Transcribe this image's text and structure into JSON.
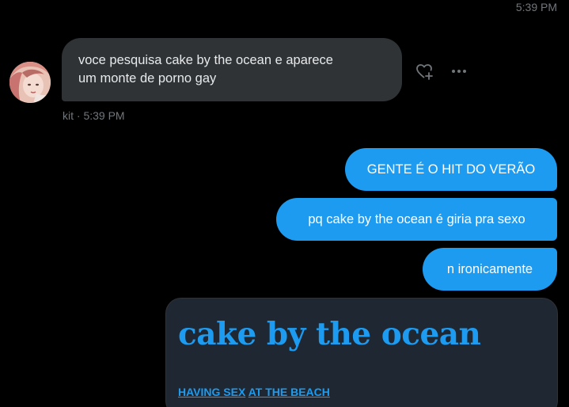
{
  "header": {
    "timestamp": "5:39 PM"
  },
  "incoming_message": {
    "text_line_1": "voce pesquisa cake by the ocean e aparece",
    "text_line_2": "um monte de porno gay",
    "sender_meta": "kit · 5:39 PM",
    "avatar": "user-avatar-photo",
    "actions": {
      "react_icon": "heart-plus-icon",
      "more_icon": "more-horizontal-icon"
    }
  },
  "outgoing_messages": [
    {
      "text": "GENTE É O HIT DO VERÃO"
    },
    {
      "text": "pq cake by the ocean é giria pra sexo"
    },
    {
      "text": "n ironicamente"
    }
  ],
  "link_card": {
    "title": "cake by the ocean",
    "link_1": "HAVING SEX",
    "link_2": "AT THE BEACH"
  },
  "colors": {
    "background": "#000000",
    "incoming_bubble": "#2f3336",
    "outgoing_bubble": "#1d9bf0",
    "card_background": "#1e2732",
    "muted_text": "#71767b"
  }
}
